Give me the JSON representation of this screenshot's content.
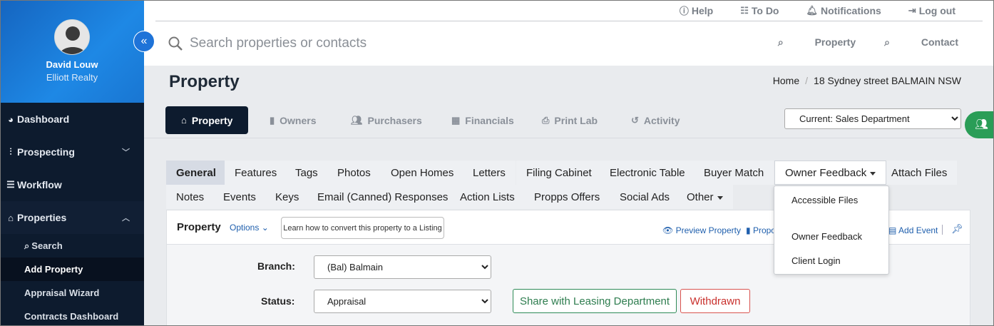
{
  "user": {
    "name": "David Louw",
    "org": "Elliott Realty"
  },
  "sidebar": {
    "items": [
      {
        "label": "Dashboard"
      },
      {
        "label": "Prospecting"
      },
      {
        "label": "Workflow"
      },
      {
        "label": "Properties"
      }
    ],
    "sub_items": [
      {
        "label": "Search"
      },
      {
        "label": "Add Property"
      },
      {
        "label": "Appraisal Wizard"
      },
      {
        "label": "Contracts Dashboard"
      }
    ]
  },
  "topbar": {
    "help": "Help",
    "todo": "To Do",
    "notifications": "Notifications",
    "logout": "Log out"
  },
  "search": {
    "placeholder": "Search properties or contacts",
    "property": "Property",
    "contact": "Contact"
  },
  "page": {
    "title": "Property"
  },
  "breadcrumb": {
    "home": "Home",
    "current": "18 Sydney street BALMAIN NSW"
  },
  "tabs": [
    {
      "label": "Property"
    },
    {
      "label": "Owners"
    },
    {
      "label": "Purchasers"
    },
    {
      "label": "Financials"
    },
    {
      "label": "Print Lab"
    },
    {
      "label": "Activity"
    }
  ],
  "department": {
    "selected": "Current: Sales Department"
  },
  "subtabs_row1": [
    {
      "label": "General"
    },
    {
      "label": "Features"
    },
    {
      "label": "Tags"
    },
    {
      "label": "Photos"
    },
    {
      "label": "Open Homes"
    },
    {
      "label": "Letters"
    },
    {
      "label": "Filing Cabinet"
    },
    {
      "label": "Electronic Table"
    },
    {
      "label": "Buyer Match"
    },
    {
      "label": "Owner Feedback"
    },
    {
      "label": "Attach Files"
    }
  ],
  "subtabs_row2": [
    {
      "label": "Notes"
    },
    {
      "label": "Events"
    },
    {
      "label": "Keys"
    },
    {
      "label": "Email (Canned) Responses"
    },
    {
      "label": "Action Lists"
    },
    {
      "label": "Propps Offers"
    },
    {
      "label": "Social Ads"
    },
    {
      "label": "Other"
    }
  ],
  "dropdown": [
    {
      "label": "Accessible Files"
    },
    {
      "label": "Owner Feedback"
    },
    {
      "label": "Client Login"
    }
  ],
  "panel": {
    "title": "Property",
    "options": "Options",
    "learn": "Learn how to convert this property to a Listing",
    "preview": "Preview Property",
    "propo": "Propo",
    "add_event": "Add Event"
  },
  "form": {
    "branch_label": "Branch:",
    "branch_value": "(Bal) Balmain",
    "status_label": "Status:",
    "status_value": "Appraisal",
    "share_btn": "Share with Leasing Department",
    "withdrawn_btn": "Withdrawn"
  }
}
